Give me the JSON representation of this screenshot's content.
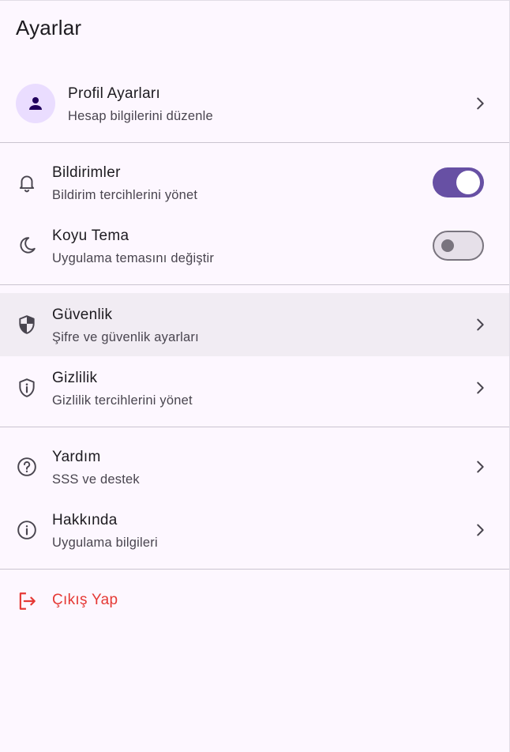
{
  "header": {
    "title": "Ayarlar"
  },
  "profile": {
    "title": "Profil Ayarları",
    "subtitle": "Hesap bilgilerini düzenle"
  },
  "preferences": {
    "notifications": {
      "title": "Bildirimler",
      "subtitle": "Bildirim tercihlerini yönet",
      "enabled": true
    },
    "dark_theme": {
      "title": "Koyu Tema",
      "subtitle": "Uygulama temasını değiştir",
      "enabled": false
    }
  },
  "privacy": {
    "security": {
      "title": "Güvenlik",
      "subtitle": "Şifre ve güvenlik ayarları"
    },
    "privacy": {
      "title": "Gizlilik",
      "subtitle": "Gizlilik tercihlerini yönet"
    }
  },
  "support": {
    "help": {
      "title": "Yardım",
      "subtitle": "SSS ve destek"
    },
    "about": {
      "title": "Hakkında",
      "subtitle": "Uygulama bilgileri"
    }
  },
  "logout": {
    "label": "Çıkış Yap"
  },
  "icons": {
    "profile": "person-icon",
    "notifications": "bell-icon",
    "dark_theme": "moon-icon",
    "security": "shield-icon",
    "privacy": "privacy-shield-icon",
    "help": "help-circle-icon",
    "about": "info-circle-icon",
    "logout": "logout-icon",
    "chevron": "chevron-right-icon"
  },
  "colors": {
    "background": "#fdf7ff",
    "primary": "#6750a4",
    "avatar_bg": "#eaddff",
    "danger": "#e53935",
    "highlight": "#f1ecf3"
  }
}
